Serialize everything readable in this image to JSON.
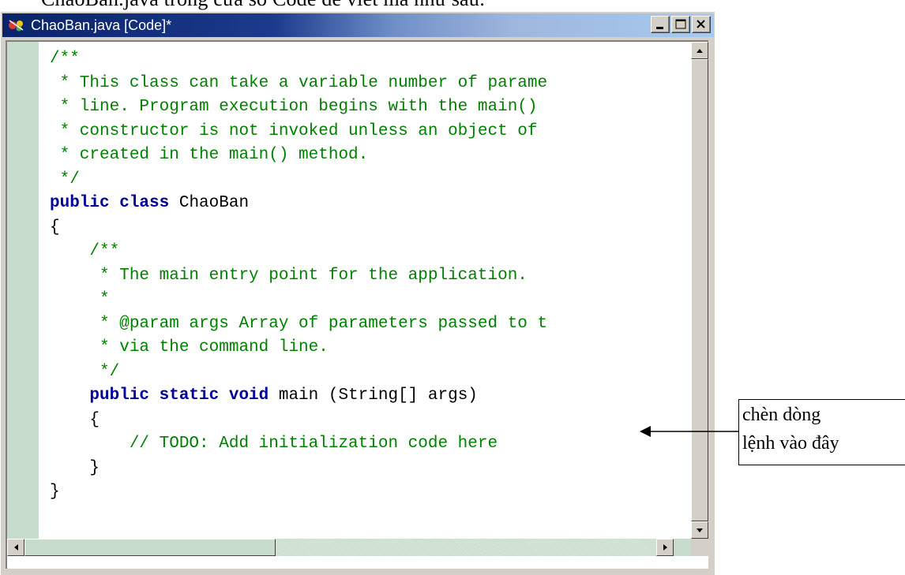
{
  "document": {
    "heading_fragment": "ChaoBan.java trong cửa sổ Code để viết mã như sau:"
  },
  "window": {
    "title": "ChaoBan.java [Code]*",
    "icon": "visual-j-app-icon",
    "caption_buttons": [
      "minimize",
      "maximize",
      "close"
    ]
  },
  "code": {
    "lines": [
      [
        {
          "t": "/**",
          "k": "comment"
        }
      ],
      [
        {
          "t": " * This class can take a variable number of parame",
          "k": "comment"
        }
      ],
      [
        {
          "t": " * line. Program execution begins with the main()",
          "k": "comment"
        }
      ],
      [
        {
          "t": " * constructor is not invoked unless an object of",
          "k": "comment"
        }
      ],
      [
        {
          "t": " * created in the main() method.",
          "k": "comment"
        }
      ],
      [
        {
          "t": " */",
          "k": "comment"
        }
      ],
      [
        {
          "t": "public class",
          "k": "keyword"
        },
        {
          "t": " ChaoBan",
          "k": "plain"
        }
      ],
      [
        {
          "t": "{",
          "k": "plain"
        }
      ],
      [
        {
          "t": "    /**",
          "k": "comment"
        }
      ],
      [
        {
          "t": "     * The main entry point for the application.",
          "k": "comment"
        }
      ],
      [
        {
          "t": "     *",
          "k": "comment"
        }
      ],
      [
        {
          "t": "     * @param args Array of parameters passed to t",
          "k": "comment"
        }
      ],
      [
        {
          "t": "     * via the command line.",
          "k": "comment"
        }
      ],
      [
        {
          "t": "     */",
          "k": "comment"
        }
      ],
      [
        {
          "t": "    public static void",
          "k": "keyword"
        },
        {
          "t": " main (String[] args)",
          "k": "plain"
        }
      ],
      [
        {
          "t": "    {",
          "k": "plain"
        }
      ],
      [
        {
          "t": "        // TODO: Add initialization code here",
          "k": "comment"
        }
      ],
      [
        {
          "t": "    }",
          "k": "plain"
        }
      ],
      [
        {
          "t": "}",
          "k": "plain"
        }
      ]
    ]
  },
  "annotation": {
    "line1": "chèn dòng",
    "line2": "lệnh vào đây"
  },
  "colors": {
    "comment": "#008000",
    "keyword": "#00009c",
    "gutter": "#c7dccc",
    "title_active": "#0a246a"
  }
}
